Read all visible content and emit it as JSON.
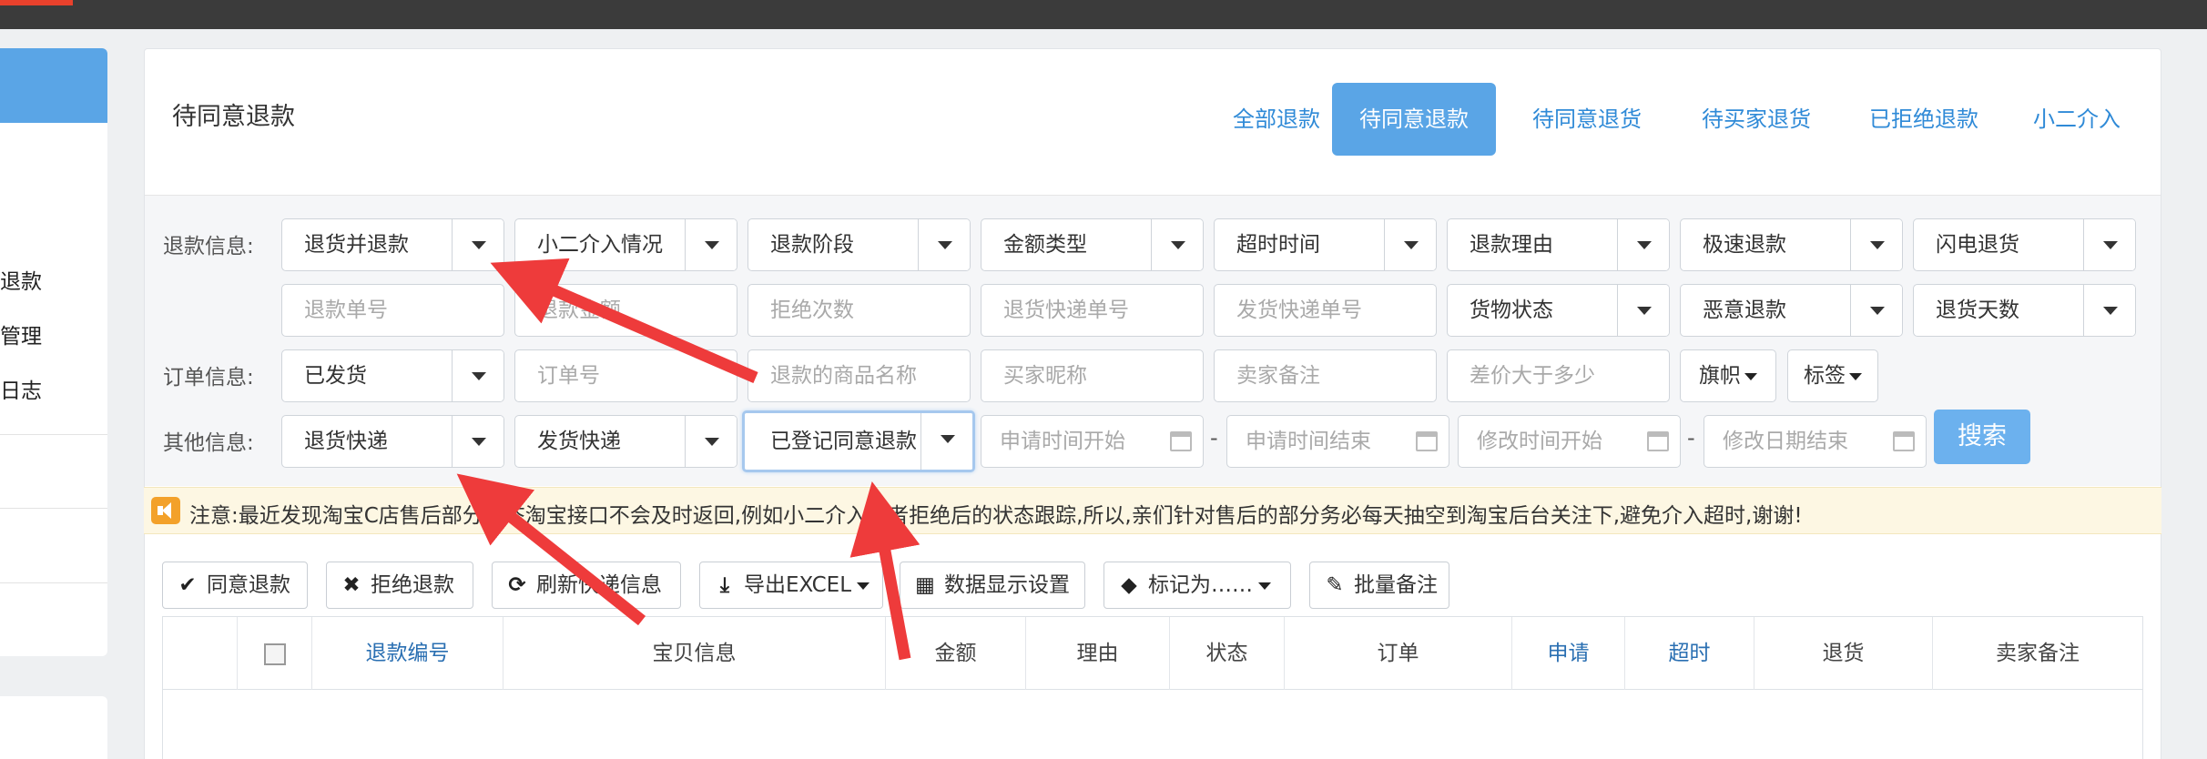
{
  "colors": {
    "accent": "#5aa5e6",
    "tab_link": "#2f8ad7",
    "search_button": "#6cb1ee",
    "arrow_red": "#ee3b3b",
    "notice_bg": "#fdf7e3"
  },
  "sidebar": {
    "items": [
      {
        "label": "退款"
      },
      {
        "label": "管理"
      },
      {
        "label": "日志"
      }
    ]
  },
  "panel": {
    "title": "待同意退款",
    "tabs": [
      {
        "label": "全部退款",
        "active": false
      },
      {
        "label": "待同意退款",
        "active": true
      },
      {
        "label": "待同意退货",
        "active": false
      },
      {
        "label": "待买家退货",
        "active": false
      },
      {
        "label": "已拒绝退款",
        "active": false
      },
      {
        "label": "小二介入",
        "active": false
      }
    ]
  },
  "filters": {
    "refund_info_label": "退款信息:",
    "order_info_label": "订单信息:",
    "other_info_label": "其他信息:",
    "refund_row1": [
      {
        "value": "退货并退款"
      },
      {
        "value": "小二介入情况"
      },
      {
        "value": "退款阶段"
      },
      {
        "value": "金额类型"
      },
      {
        "value": "超时时间"
      },
      {
        "value": "退款理由"
      },
      {
        "value": "极速退款"
      },
      {
        "value": "闪电退货"
      }
    ],
    "refund_row2": [
      {
        "placeholder": "退款单号"
      },
      {
        "placeholder": "退款金额"
      },
      {
        "placeholder": "拒绝次数"
      },
      {
        "placeholder": "退货快递单号"
      },
      {
        "placeholder": "发货快递单号"
      },
      {
        "value": "货物状态"
      },
      {
        "value": "恶意退款"
      },
      {
        "value": "退货天数"
      }
    ],
    "order_row": [
      {
        "value": "已发货"
      },
      {
        "placeholder": "订单号"
      },
      {
        "placeholder": "退款的商品名称"
      },
      {
        "placeholder": "买家昵称"
      },
      {
        "placeholder": "卖家备注"
      },
      {
        "placeholder": "差价大于多少"
      }
    ],
    "flag_label": "旗帜",
    "tag_label": "标签",
    "other_row": [
      {
        "value": "退货快递"
      },
      {
        "value": "发货快递"
      },
      {
        "value": "已登记同意退款"
      }
    ],
    "dates": [
      {
        "placeholder": "申请时间开始"
      },
      {
        "placeholder": "申请时间结束"
      },
      {
        "placeholder": "修改时间开始"
      },
      {
        "placeholder": "修改日期结束"
      }
    ],
    "dash": "-",
    "search_label": "搜索"
  },
  "notice": {
    "text": "注意:最近发现淘宝C店售后部分状态淘宝接口不会及时返回,例如小二介入或者拒绝后的状态跟踪,所以,亲们针对售后的部分务必每天抽空到淘宝后台关注下,避免介入超时,谢谢!"
  },
  "toolbar": {
    "agree": {
      "icon": "check-icon",
      "label": "同意退款"
    },
    "reject": {
      "icon": "times-icon",
      "label": "拒绝退款"
    },
    "refresh": {
      "icon": "refresh-icon",
      "label": "刷新快递信息"
    },
    "export": {
      "icon": "download-icon",
      "label": "导出EXCEL"
    },
    "display": {
      "icon": "grid-icon",
      "label": "数据显示设置"
    },
    "mark": {
      "icon": "tag-icon",
      "label": "标记为……"
    },
    "remark": {
      "icon": "edit-icon",
      "label": "批量备注"
    }
  },
  "table": {
    "headers": [
      "退款编号",
      "宝贝信息",
      "金额",
      "理由",
      "状态",
      "订单",
      "申请",
      "超时",
      "退货",
      "卖家备注"
    ]
  }
}
